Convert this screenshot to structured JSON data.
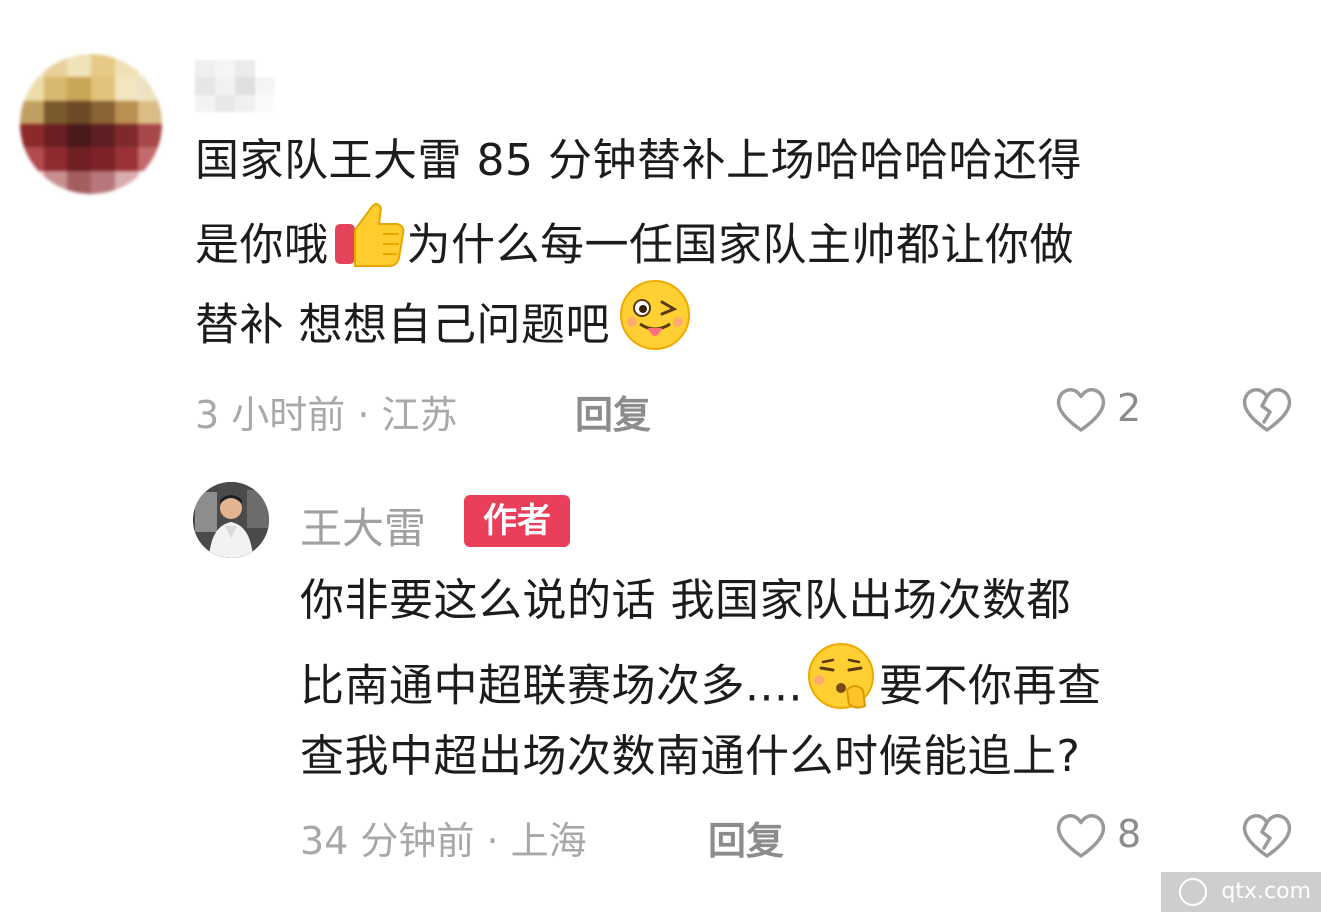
{
  "comment": {
    "text_line1": "国家队王大雷 85 分钟替补上场哈哈哈哈还得",
    "text_line2a": "是你哦",
    "text_line2b": "为什么每一任国家队主帅都让你做",
    "text_line3": "替补 想想自己问题吧",
    "time_location": "3 小时前 · 江苏",
    "reply_label": "回复",
    "like_count": "2"
  },
  "reply": {
    "username": "王大雷",
    "badge": "作者",
    "text_line1": "你非要这么说的话 我国家队出场次数都",
    "text_line2a": "比南通中超联赛场次多....",
    "text_line2b": "要不你再查",
    "text_line3": "查我中超出场次数南通什么时候能追上?",
    "time_location": "34 分钟前 · 上海",
    "reply_label": "回复",
    "like_count": "8"
  },
  "watermark": {
    "text": "qtx.com"
  },
  "icons": [
    "heart-outline-icon",
    "broken-heart-icon",
    "thumbs-up-emoji",
    "wink-tongue-emoji",
    "shushing-emoji"
  ],
  "colors": {
    "badge_bg": "#ea3f5a",
    "meta_text": "#a8a8a8",
    "body_text": "#1c1c1c"
  }
}
